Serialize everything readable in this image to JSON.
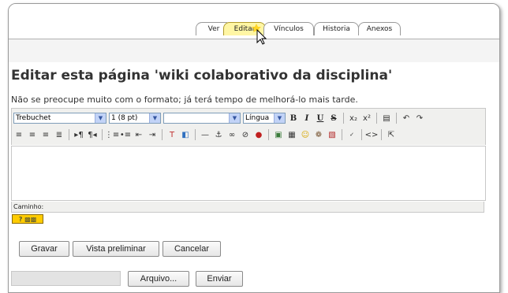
{
  "tabs": [
    {
      "label": "Ver",
      "active": false
    },
    {
      "label": "Editar",
      "active": true
    },
    {
      "label": "Vínculos",
      "active": false
    },
    {
      "label": "Historia",
      "active": false
    },
    {
      "label": "Anexos",
      "active": false
    }
  ],
  "page_title": "Editar esta página 'wiki colaborativo da disciplina'",
  "hint": "Não se preocupe muito com o formato; já terá tempo de melhorá-lo mais tarde.",
  "toolbar": {
    "font_family": "Trebuchet",
    "font_size": "1 (8 pt)",
    "format": "",
    "language": "Língua",
    "bold": "B",
    "italic": "I",
    "underline": "U",
    "strike": "S"
  },
  "path_label": "Caminho:",
  "help_label": "?",
  "buttons": {
    "save": "Gravar",
    "preview": "Vista preliminar",
    "cancel": "Cancelar",
    "browse": "Arquivo...",
    "upload": "Enviar"
  },
  "colors": {
    "active_tab": "#fff6a4",
    "help_bg": "#ffcc00",
    "title": "#333333"
  }
}
